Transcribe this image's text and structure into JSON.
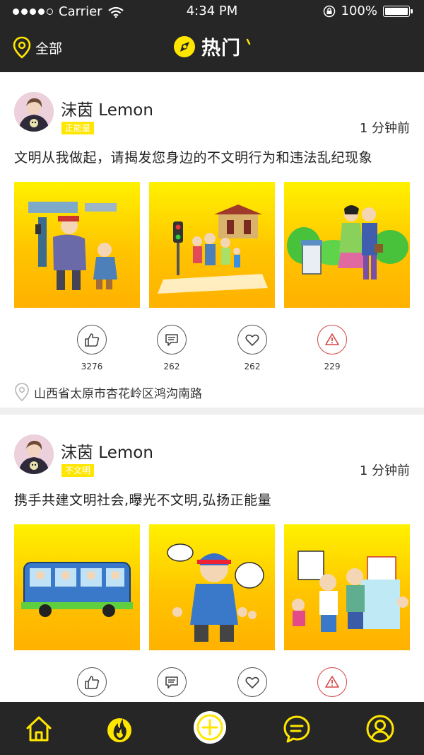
{
  "status_bar": {
    "carrier": "Carrier",
    "time": "4:34 PM",
    "battery": "100%"
  },
  "header": {
    "location_label": "全部",
    "title": "热门"
  },
  "posts": [
    {
      "username": "沫茵 Lemon",
      "tag": "正能量",
      "time": "1 分钟前",
      "content": "文明从我做起，请揭发您身边的不文明行为和违法乱纪现象",
      "likes": "3276",
      "comments": "262",
      "favorites": "262",
      "reports": "229",
      "location": "山西省太原市杏花岭区鸿沟南路"
    },
    {
      "username": "沫茵 Lemon",
      "tag": "不文明",
      "time": "1 分钟前",
      "content": "携手共建文明社会,曝光不文明,弘扬正能量"
    }
  ],
  "colors": {
    "accent": "#ffe600",
    "dark_bar": "#262626",
    "warn": "#d64545"
  },
  "tabs": [
    "home-icon",
    "fire-icon",
    "add-icon",
    "message-icon",
    "profile-icon"
  ]
}
